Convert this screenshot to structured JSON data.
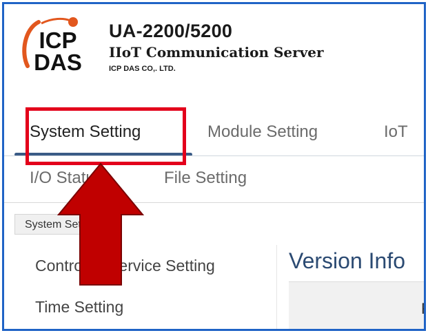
{
  "header": {
    "logo": {
      "line1": "ICP",
      "line2": "DAS",
      "icon": "icpdas-logo-icon"
    },
    "product_title": "UA-2200/5200",
    "product_subtitle": "IIoT Communication Server",
    "company": "ICP DAS CO,. LTD."
  },
  "main_tabs": [
    {
      "label": "System Setting",
      "active": true
    },
    {
      "label": "Module Setting",
      "active": false
    },
    {
      "label": "IoT",
      "active": false
    }
  ],
  "sub_tabs": [
    {
      "label": "I/O Status"
    },
    {
      "label": "File Setting"
    }
  ],
  "breadcrumb": {
    "label": "System Setting"
  },
  "side_menu": [
    {
      "label": "Controller Service Setting"
    },
    {
      "label": "Time Setting"
    }
  ],
  "content": {
    "title": "Version Info",
    "table_header": "F"
  },
  "colors": {
    "frame_border": "#1f63c6",
    "highlight": "#e3001b",
    "arrow": "#c00000",
    "tab_underline": "#3a5b86",
    "title_blue": "#2b4a72",
    "logo_orange": "#e2571e"
  }
}
